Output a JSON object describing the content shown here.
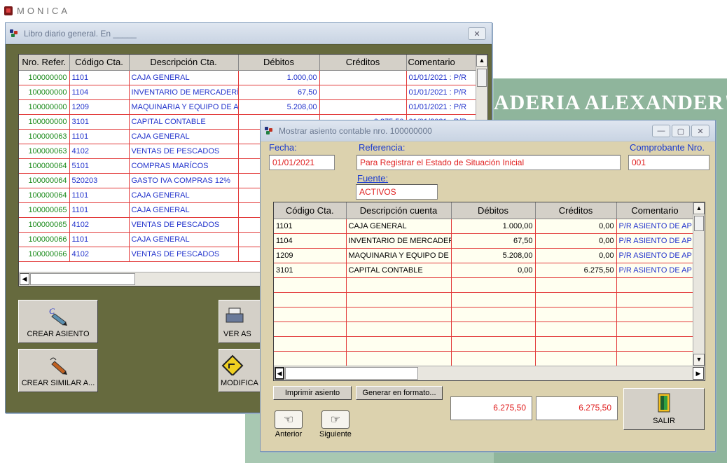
{
  "app": {
    "name": "MONICA"
  },
  "banner": {
    "text": "ADERIA ALEXANDER\""
  },
  "libro": {
    "title": "Libro diario general. En _____",
    "columns": [
      "Nro. Refer.",
      "Código Cta.",
      "Descripción Cta.",
      "Débitos",
      "Créditos",
      "Comentario"
    ],
    "rows": [
      {
        "ref": "100000000",
        "cod": "1101",
        "desc": "CAJA GENERAL",
        "deb": "1.000,00",
        "cred": "",
        "com": "01/01/2021 : P/R"
      },
      {
        "ref": "100000000",
        "cod": "1104",
        "desc": "INVENTARIO DE MERCADERÍ",
        "deb": "67,50",
        "cred": "",
        "com": "01/01/2021 : P/R"
      },
      {
        "ref": "100000000",
        "cod": "1209",
        "desc": "MAQUINARIA Y EQUIPO DE A",
        "deb": "5.208,00",
        "cred": "",
        "com": "01/01/2021 : P/R"
      },
      {
        "ref": "100000000",
        "cod": "3101",
        "desc": "CAPITAL CONTABLE",
        "deb": "",
        "cred": "6.275,50",
        "com": "01/01/2021 : P/R"
      },
      {
        "ref": "100000063",
        "cod": "1101",
        "desc": "CAJA GENERAL",
        "deb": "",
        "cred": "",
        "com": ""
      },
      {
        "ref": "100000063",
        "cod": "4102",
        "desc": "VENTAS DE PESCADOS",
        "deb": "",
        "cred": "",
        "com": ""
      },
      {
        "ref": "100000064",
        "cod": "5101",
        "desc": "COMPRAS MARÍCOS",
        "deb": "",
        "cred": "",
        "com": ""
      },
      {
        "ref": "100000064",
        "cod": "520203",
        "desc": "GASTO IVA COMPRAS 12%",
        "deb": "",
        "cred": "",
        "com": ""
      },
      {
        "ref": "100000064",
        "cod": "1101",
        "desc": "CAJA GENERAL",
        "deb": "",
        "cred": "",
        "com": ""
      },
      {
        "ref": "100000065",
        "cod": "1101",
        "desc": "CAJA GENERAL",
        "deb": "",
        "cred": "",
        "com": ""
      },
      {
        "ref": "100000065",
        "cod": "4102",
        "desc": "VENTAS DE PESCADOS",
        "deb": "",
        "cred": "",
        "com": ""
      },
      {
        "ref": "100000066",
        "cod": "1101",
        "desc": "CAJA GENERAL",
        "deb": "",
        "cred": "",
        "com": ""
      },
      {
        "ref": "100000066",
        "cod": "4102",
        "desc": "VENTAS DE PESCADOS",
        "deb": "",
        "cred": "",
        "com": ""
      }
    ],
    "buttons": {
      "crear": "CREAR ASIENTO",
      "ver": "VER AS",
      "similar": "CREAR SIMILAR A...",
      "modifica": "MODIFICA"
    }
  },
  "asiento": {
    "title": "Mostrar asiento contable nro. 100000000",
    "fecha_label": "Fecha:",
    "fecha": "01/01/2021",
    "referencia_label": "Referencia:",
    "referencia": "Para Registrar el Estado de Situación Inicial",
    "comprobante_label": "Comprobante Nro.",
    "comprobante": "001",
    "fuente_label": "Fuente:",
    "fuente": "ACTIVOS",
    "columns": [
      "Código Cta.",
      "Descripción cuenta",
      "Débitos",
      "Créditos",
      "Comentario"
    ],
    "rows": [
      {
        "cod": "1101",
        "desc": "CAJA GENERAL",
        "deb": "1.000,00",
        "cred": "0,00",
        "com": "P/R ASIENTO DE AP"
      },
      {
        "cod": "1104",
        "desc": "INVENTARIO DE MERCADER",
        "deb": "67,50",
        "cred": "0,00",
        "com": "P/R ASIENTO DE AP"
      },
      {
        "cod": "1209",
        "desc": "MAQUINARIA Y EQUIPO DE",
        "deb": "5.208,00",
        "cred": "0,00",
        "com": "P/R ASIENTO DE AP"
      },
      {
        "cod": "3101",
        "desc": "CAPITAL CONTABLE",
        "deb": "0,00",
        "cred": "6.275,50",
        "com": "P/R ASIENTO DE AP"
      }
    ],
    "imprimir": "Imprimir asiento",
    "generar": "Generar en formato...",
    "total_debitos": "6.275,50",
    "total_creditos": "6.275,50",
    "anterior": "Anterior",
    "siguiente": "Siguiente",
    "salir": "SALIR"
  }
}
